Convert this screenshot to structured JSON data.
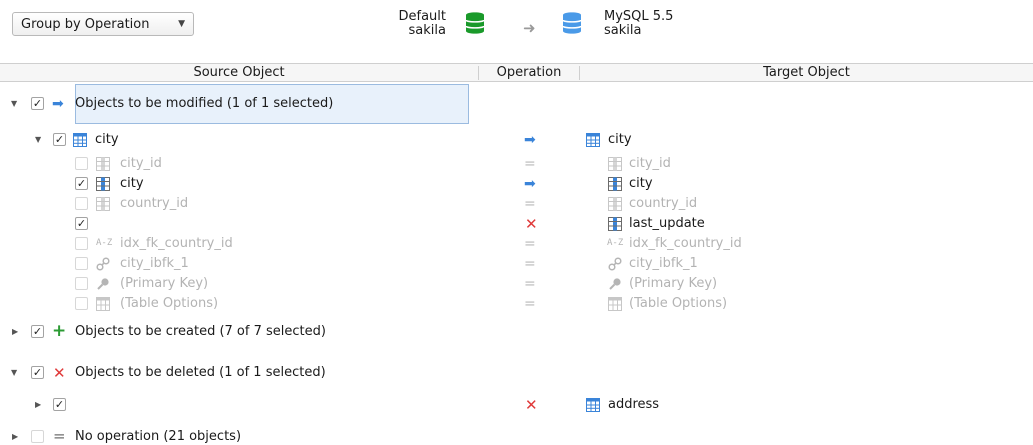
{
  "toolbar": {
    "group_by": "Group by Operation",
    "source_db": {
      "line1": "Default",
      "line2": "sakila"
    },
    "target_db": {
      "line1": "MySQL 5.5",
      "line2": "sakila"
    }
  },
  "header": {
    "source": "Source Object",
    "operation": "Operation",
    "target": "Target Object"
  },
  "groups": {
    "modified": "Objects to be modified (1 of 1 selected)",
    "created": "Objects to be created (7 of 7 selected)",
    "deleted": "Objects to be deleted (1 of 1 selected)",
    "noop": "No operation (21 objects)"
  },
  "table_city": {
    "source": "city",
    "target": "city"
  },
  "columns": [
    {
      "source": "city_id",
      "target": "city_id"
    },
    {
      "source": "city",
      "target": "city"
    },
    {
      "source": "country_id",
      "target": "country_id"
    },
    {
      "source": "",
      "target": "last_update"
    },
    {
      "source": "idx_fk_country_id",
      "target": "idx_fk_country_id"
    },
    {
      "source": "city_ibfk_1",
      "target": "city_ibfk_1"
    },
    {
      "source": "(Primary Key)",
      "target": "(Primary Key)"
    },
    {
      "source": "(Table Options)",
      "target": "(Table Options)"
    }
  ],
  "deleted_row": {
    "target": "address"
  },
  "icon_text": {
    "index": "A-Z"
  },
  "colors": {
    "accent_blue": "#3a84d9",
    "delete_red": "#e03a3a",
    "create_green": "#2c9b34",
    "db_green": "#1a9a2a",
    "db_blue": "#4a9ae8"
  }
}
